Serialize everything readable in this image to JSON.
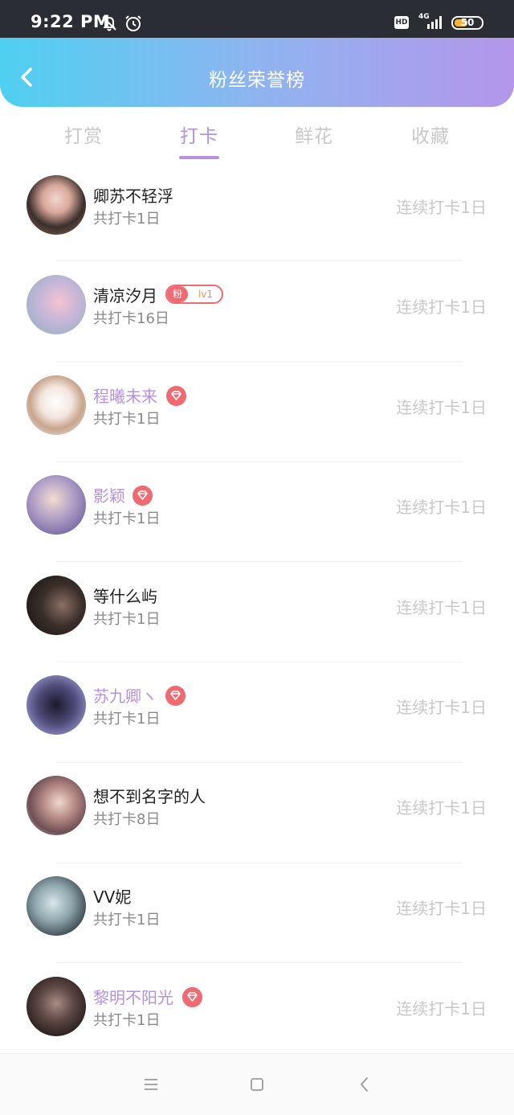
{
  "status_bar": {
    "time": "9:22 PM",
    "hd": "HD",
    "network": "4G",
    "battery": "50",
    "battery_level": 0.5
  },
  "header": {
    "title": "粉丝荣誉榜",
    "back_icon": "chevron-left-icon"
  },
  "tabs": [
    {
      "label": "打赏",
      "active": false
    },
    {
      "label": "打卡",
      "active": true
    },
    {
      "label": "鲜花",
      "active": false
    },
    {
      "label": "收藏",
      "active": false
    }
  ],
  "colors": {
    "accent": "#b592e0",
    "badge": "#f06a72",
    "header_gradient_start": "#4fd0f0",
    "header_gradient_end": "#b496ea"
  },
  "list": [
    {
      "name": "卿苏不轻浮",
      "vip": false,
      "badge": "none",
      "total": "共打卡1日",
      "streak": "连续打卡1日"
    },
    {
      "name": "清凉汐月",
      "vip": false,
      "badge": "fan",
      "fan_label": "粉",
      "fan_level": "lv1",
      "total": "共打卡16日",
      "streak": "连续打卡1日"
    },
    {
      "name": "程曦未来",
      "vip": true,
      "badge": "gem",
      "total": "共打卡1日",
      "streak": "连续打卡1日"
    },
    {
      "name": "影颖",
      "vip": true,
      "badge": "gem",
      "total": "共打卡1日",
      "streak": "连续打卡1日"
    },
    {
      "name": "等什么屿",
      "vip": false,
      "badge": "none",
      "total": "共打卡1日",
      "streak": "连续打卡1日"
    },
    {
      "name": "苏九卿ヽ",
      "vip": true,
      "badge": "gem",
      "total": "共打卡1日",
      "streak": "连续打卡1日"
    },
    {
      "name": "想不到名字的人",
      "vip": false,
      "badge": "none",
      "total": "共打卡8日",
      "streak": "连续打卡1日"
    },
    {
      "name": "VV妮",
      "vip": false,
      "badge": "none",
      "total": "共打卡1日",
      "streak": "连续打卡1日"
    },
    {
      "name": "黎明不阳光",
      "vip": true,
      "badge": "gem",
      "total": "共打卡1日",
      "streak": "连续打卡1日"
    }
  ],
  "nav_bar": {
    "menu_icon": "menu-icon",
    "home_icon": "home-square-icon",
    "back_icon": "back-chevron-icon"
  }
}
